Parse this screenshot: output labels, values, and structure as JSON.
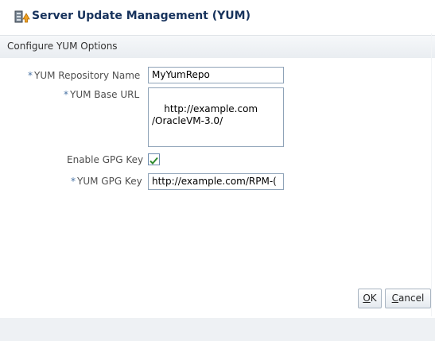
{
  "dialog": {
    "title": "Server Update Management (YUM)",
    "title_icon": "server-update-icon"
  },
  "section": {
    "title": "Configure YUM Options"
  },
  "form": {
    "repo_name": {
      "label": "YUM Repository Name",
      "required_marker": "*",
      "value": "MyYumRepo"
    },
    "base_url": {
      "label": "YUM Base URL",
      "required_marker": "*",
      "value": "http://example.com\n/OracleVM-3.0/"
    },
    "enable_gpg": {
      "label": "Enable GPG Key",
      "checked": true
    },
    "gpg_key": {
      "label": "YUM GPG Key",
      "required_marker": "*",
      "value": "http://example.com/RPM-("
    }
  },
  "buttons": {
    "ok": {
      "mnemonic": "O",
      "rest": "K"
    },
    "cancel": {
      "mnemonic": "C",
      "rest": "ancel"
    }
  },
  "colors": {
    "title": "#16325c",
    "checkmark": "#2e8b2e",
    "required": "#4a74a5"
  }
}
